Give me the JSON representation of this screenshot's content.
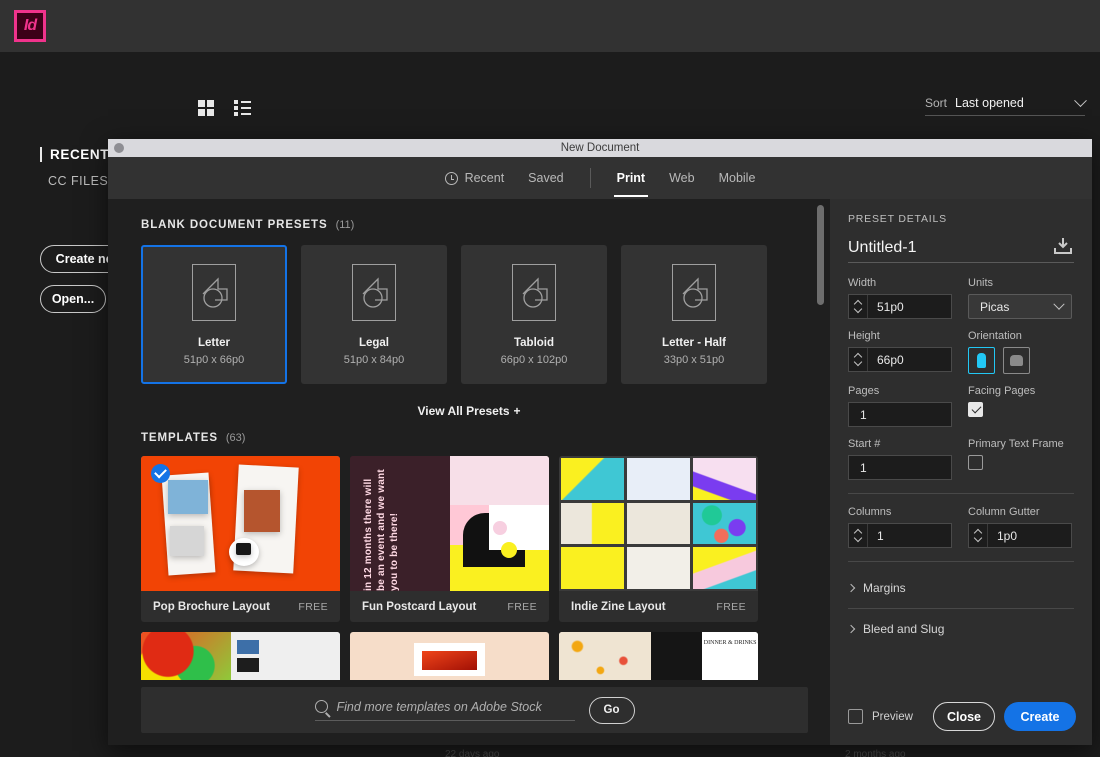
{
  "app": {
    "logo_text": "Id",
    "sort_label": "Sort",
    "sort_value": "Last opened",
    "nav": {
      "recent": "RECENT",
      "cc_files": "CC FILES"
    },
    "buttons": {
      "create_new": "Create new...",
      "open": "Open..."
    },
    "footer_hints": [
      "22 days ago",
      "2 months ago"
    ]
  },
  "dialog": {
    "title": "New Document",
    "tabs": [
      {
        "label": "Recent",
        "icon": "clock-icon",
        "active": false
      },
      {
        "label": "Saved",
        "active": false
      },
      {
        "label": "Print",
        "active": true
      },
      {
        "label": "Web",
        "active": false
      },
      {
        "label": "Mobile",
        "active": false
      }
    ],
    "presets_section": {
      "title": "BLANK DOCUMENT PRESETS",
      "count": "(11)",
      "view_all": "View All Presets",
      "view_all_plus": "+",
      "items": [
        {
          "name": "Letter",
          "dims": "51p0 x 66p0",
          "selected": true
        },
        {
          "name": "Legal",
          "dims": "51p0 x 84p0",
          "selected": false
        },
        {
          "name": "Tabloid",
          "dims": "66p0 x 102p0",
          "selected": false
        },
        {
          "name": "Letter - Half",
          "dims": "33p0 x 51p0",
          "selected": false
        }
      ]
    },
    "templates_section": {
      "title": "TEMPLATES",
      "count": "(63)",
      "items": [
        {
          "name": "Pop Brochure Layout",
          "price": "FREE",
          "selected": true
        },
        {
          "name": "Fun Postcard Layout",
          "price": "FREE",
          "selected": false
        },
        {
          "name": "Indie Zine Layout",
          "price": "FREE",
          "selected": false
        }
      ],
      "postcard_art_text": "in 12 months there will be an event and we want you to be there!",
      "dinner_art_text": "DINNER & DRINKS"
    },
    "stock_search": {
      "placeholder": "Find more templates on Adobe Stock",
      "go_label": "Go",
      "icon": "search-icon"
    },
    "preset_details": {
      "title": "PRESET DETAILS",
      "document_name": "Untitled-1",
      "save_preset_icon": "save-preset-icon",
      "width": {
        "label": "Width",
        "value": "51p0"
      },
      "units": {
        "label": "Units",
        "value": "Picas"
      },
      "height": {
        "label": "Height",
        "value": "66p0"
      },
      "orientation": {
        "label": "Orientation",
        "portrait_selected": true
      },
      "pages": {
        "label": "Pages",
        "value": "1"
      },
      "facing_pages": {
        "label": "Facing Pages",
        "checked": true
      },
      "start_number": {
        "label": "Start #",
        "value": "1"
      },
      "primary_text_frame": {
        "label": "Primary Text Frame",
        "checked": false
      },
      "columns": {
        "label": "Columns",
        "value": "1"
      },
      "column_gutter": {
        "label": "Column Gutter",
        "value": "1p0"
      },
      "margins": {
        "label": "Margins"
      },
      "bleed_and_slug": {
        "label": "Bleed and Slug"
      }
    },
    "footer": {
      "preview_label": "Preview",
      "preview_checked": false,
      "close_label": "Close",
      "create_label": "Create"
    }
  },
  "colors": {
    "accent_blue": "#1473e6",
    "logo_pink": "#f0338c",
    "orientation_cyan": "#22c8f5"
  }
}
